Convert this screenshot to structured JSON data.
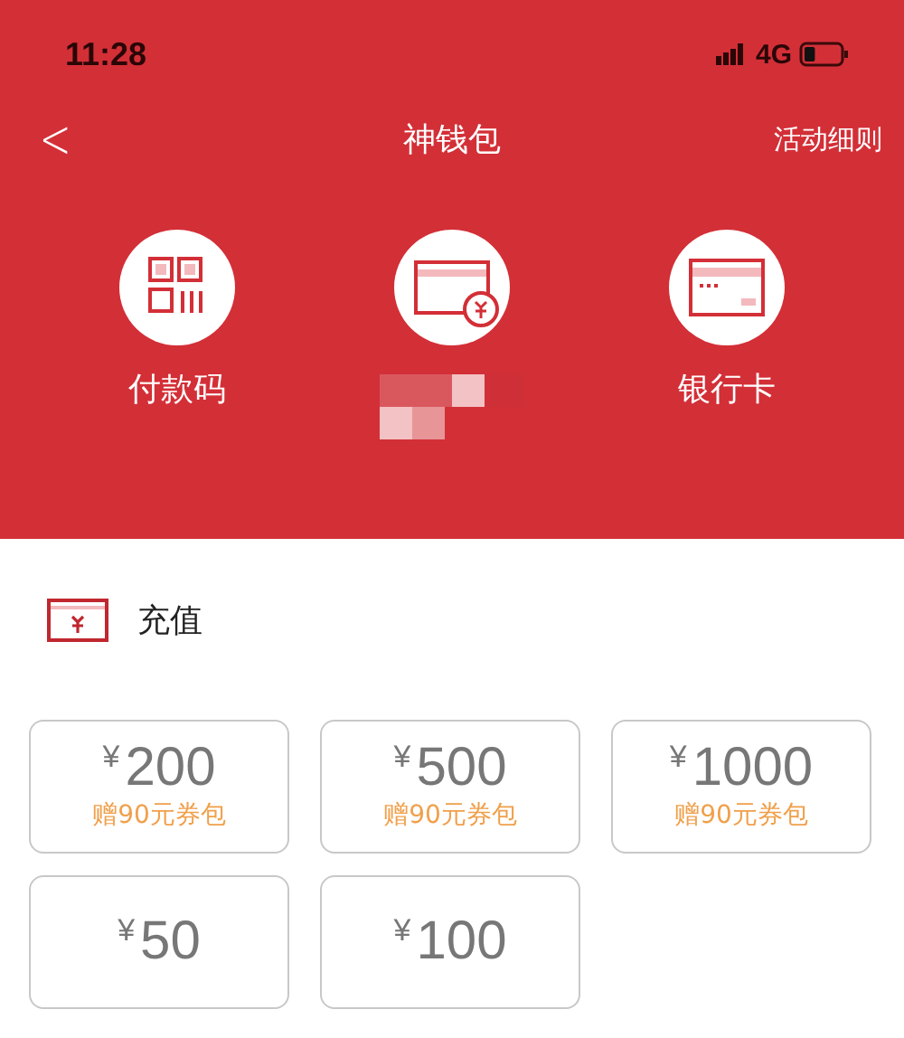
{
  "status_bar": {
    "time": "11:28",
    "network": "4G",
    "battery": {
      "level": 0.3
    }
  },
  "nav": {
    "back": "<",
    "title": "神钱包",
    "action": "活动细则"
  },
  "shortcuts": [
    {
      "kind": "qr",
      "label": "付款码"
    },
    {
      "kind": "balance"
    },
    {
      "kind": "card",
      "label": "银行卡"
    }
  ],
  "recharge": {
    "title": "充值",
    "options": [
      {
        "currency": "¥",
        "amount": "200",
        "bonus": "赠90元券包"
      },
      {
        "currency": "¥",
        "amount": "500",
        "bonus": "赠90元券包"
      },
      {
        "currency": "¥",
        "amount": "1000",
        "bonus": "赠90元券包"
      },
      {
        "currency": "¥",
        "amount": "50"
      },
      {
        "currency": "¥",
        "amount": "100"
      }
    ]
  }
}
